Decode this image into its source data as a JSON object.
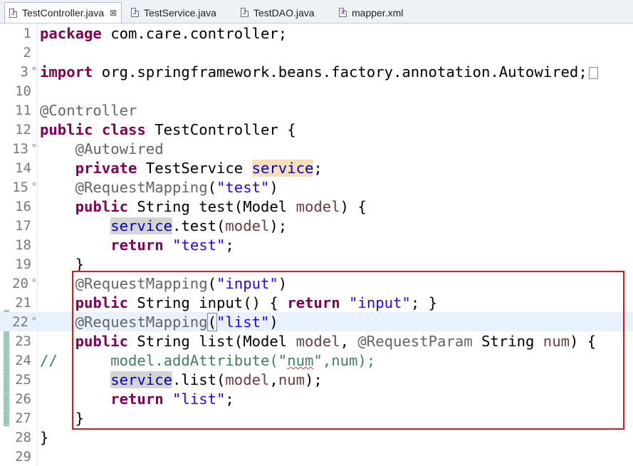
{
  "tabs": [
    {
      "label": "TestController.java",
      "icon": "java-file-icon",
      "active": true,
      "closable": true
    },
    {
      "label": "TestService.java",
      "icon": "java-file-icon"
    },
    {
      "label": "TestDAO.java",
      "icon": "java-file-icon"
    },
    {
      "label": "mapper.xml",
      "icon": "xml-file-icon"
    }
  ],
  "tab_close_glyph": "⊠",
  "editor": {
    "current_line": 22,
    "annotation_box_color": "#e8161b",
    "lines": [
      {
        "n": "1"
      },
      {
        "n": "2"
      },
      {
        "n": "3",
        "fold": "⊕"
      },
      {
        "n": "10"
      },
      {
        "n": "11"
      },
      {
        "n": "12"
      },
      {
        "n": "13",
        "fold": "⊖"
      },
      {
        "n": "14"
      },
      {
        "n": "15",
        "fold": "⊖"
      },
      {
        "n": "16"
      },
      {
        "n": "17"
      },
      {
        "n": "18"
      },
      {
        "n": "19"
      },
      {
        "n": "20",
        "fold": "⊖"
      },
      {
        "n": "21"
      },
      {
        "n": "22",
        "fold": "⊖"
      },
      {
        "n": "23"
      },
      {
        "n": "24"
      },
      {
        "n": "25"
      },
      {
        "n": "26"
      },
      {
        "n": "27"
      },
      {
        "n": "28"
      },
      {
        "n": "29"
      }
    ],
    "code": {
      "l1_kw": "package",
      "l1_rest": " com.care.controller;",
      "l3_kw": "import",
      "l3_rest": " org.springframework.beans.factory.annotation.Autowired;",
      "l11_an": "@Controller",
      "l12_kw1": "public",
      "l12_kw2": "class",
      "l12_rest": " TestController {",
      "l13_an": "@Autowired",
      "l14_kw": "private",
      "l14_type": " TestService ",
      "l14_field": "service",
      "l14_end": ";",
      "l15_an": "@RequestMapping",
      "l15_open": "(",
      "l15_str": "\"test\"",
      "l15_close": ")",
      "l16_kw": "public",
      "l16_a": " String test(Model ",
      "l16_var": "model",
      "l16_b": ") {",
      "l17_field": "service",
      "l17_a": ".test(",
      "l17_var": "model",
      "l17_b": ");",
      "l18_kw": "return",
      "l18_str": "\"test\"",
      "l18_end": ";",
      "l19_brace": "}",
      "l20_an": "@RequestMapping",
      "l20_open": "(",
      "l20_str": "\"input\"",
      "l20_close": ")",
      "l21_kw": "public",
      "l21_a": " String input() { ",
      "l21_kw2": "return",
      "l21_str": "\"input\"",
      "l21_b": "; }",
      "l22_an": "@RequestMapping",
      "l22_open": "(",
      "l22_str": "\"list\"",
      "l22_close": ")",
      "l23_kw": "public",
      "l23_a": " String list(Model ",
      "l23_var": "model",
      "l23_b": ", ",
      "l23_an": "@RequestParam",
      "l23_c": " String ",
      "l23_var2": "num",
      "l23_d": ") {",
      "l24_cm1": "//",
      "l24_cm2": "model.addAttribute(\"",
      "l24_cm3": "num",
      "l24_cm4": "\",num);",
      "l25_field": "service",
      "l25_a": ".list(",
      "l25_var": "model",
      "l25_b": ",",
      "l25_var2": "num",
      "l25_c": ");",
      "l26_kw": "return",
      "l26_str": "\"list\"",
      "l26_end": ";",
      "l27_brace": "}",
      "l28_brace": "}"
    }
  }
}
